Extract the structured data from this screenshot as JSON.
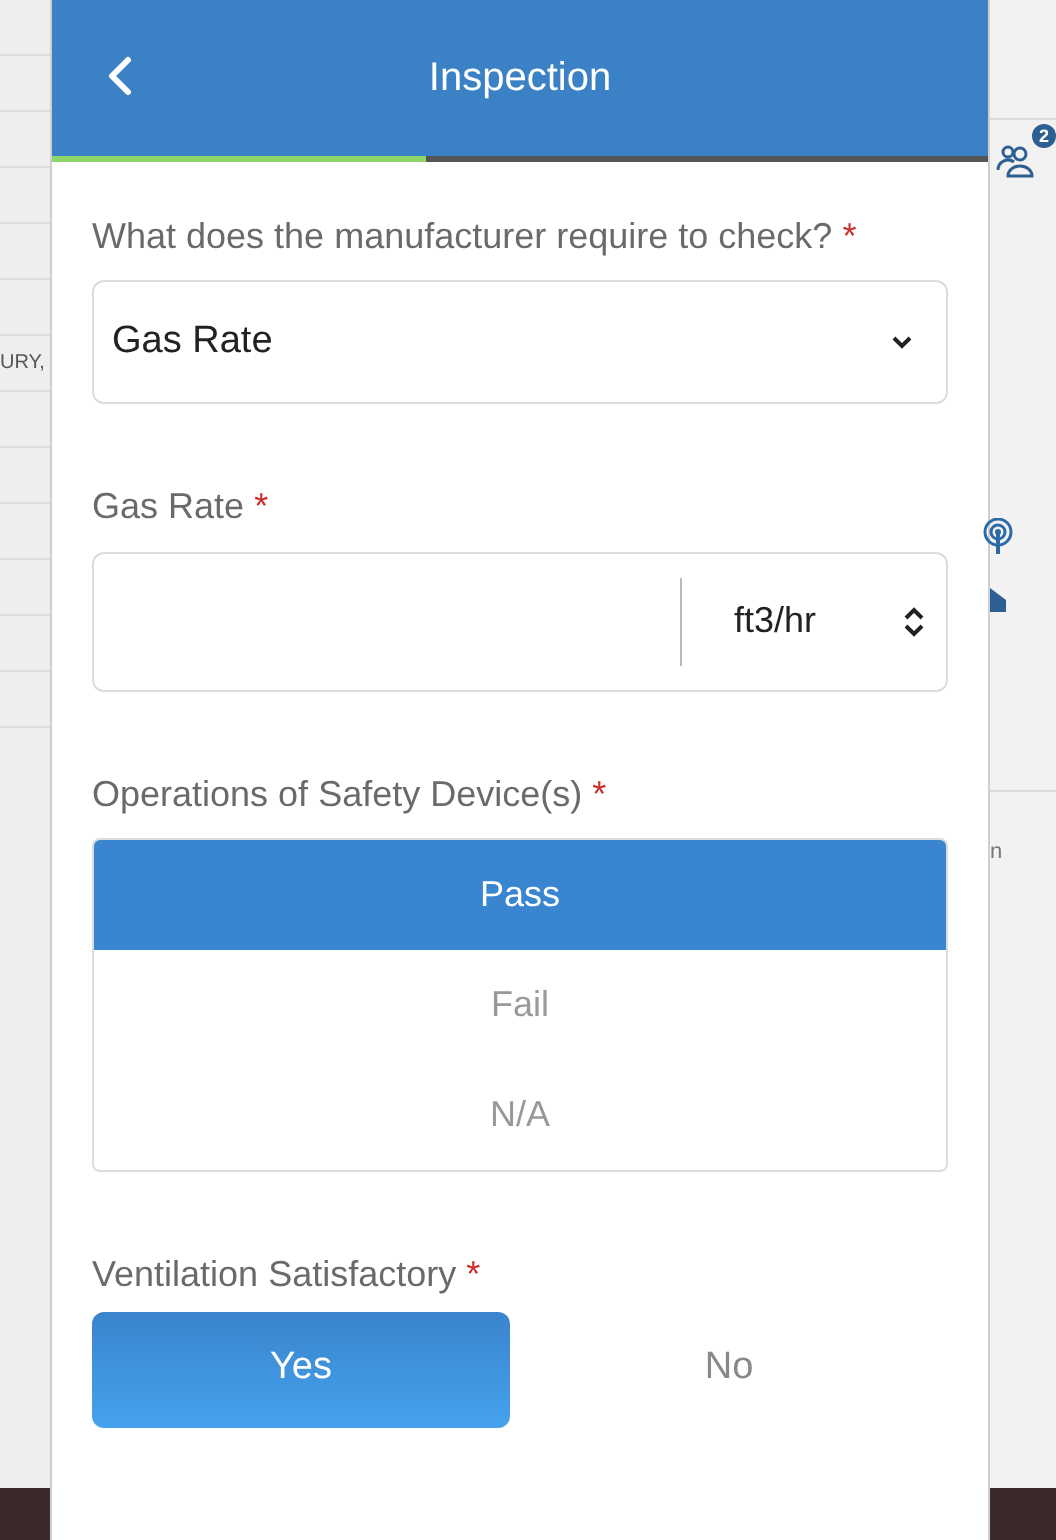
{
  "background": {
    "left_text": "URY,",
    "badge": "2",
    "right_text": "n"
  },
  "header": {
    "title": "Inspection",
    "progress": {
      "level": 0.4
    }
  },
  "fields": [
    {
      "kind": "select",
      "label": "What does the manufacturer require to check?",
      "required_mark": "*",
      "value": "Gas Rate"
    },
    {
      "kind": "number_unit",
      "label": "Gas Rate",
      "required_mark": "*",
      "unit": "ft3/hr"
    },
    {
      "kind": "list_choice",
      "label": "Operations of Safety Device(s)",
      "required_mark": "*",
      "options": [
        {
          "label": "Pass",
          "selected": true
        },
        {
          "label": "Fail",
          "selected": false
        },
        {
          "label": "N/A",
          "selected": false
        }
      ]
    },
    {
      "kind": "toggle_choice",
      "label": "Ventilation Satisfactory",
      "required_mark": "*",
      "options": [
        {
          "label": "Yes",
          "selected": true
        },
        {
          "label": "No",
          "selected": false
        }
      ]
    }
  ]
}
